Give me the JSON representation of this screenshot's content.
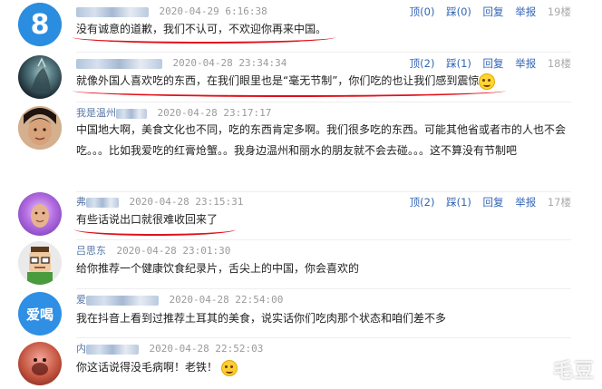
{
  "actions": {
    "up": "顶",
    "down": "踩",
    "reply": "回复",
    "report": "举报"
  },
  "comments": [
    {
      "user": "",
      "time": "2020-04-29 6:16:38",
      "up": "(0)",
      "down": "(0)",
      "floor": "19楼",
      "text": "没有诚意的道歉，我们不认可，不欢迎你再来中国。",
      "avatar": "blue-circle-8-avatar"
    },
    {
      "user": "",
      "time": "2020-04-28 23:34:34",
      "up": "(2)",
      "down": "(1)",
      "floor": "18楼",
      "text": "就像外国人喜欢吃的东西，在我们眼里也是“毫无节制”，你们吃的也让我们感到震惊",
      "avatar": "dark-fantasy-avatar"
    },
    {
      "user": "我是温州",
      "time": "2020-04-28 23:17:17",
      "up": "",
      "down": "",
      "floor": "",
      "text": "中国地大啊，美食文化也不同，吃的东西肯定多啊。我们很多吃的东西。可能其他省或者市的人也不会吃。。。比如我爱吃的红膏炝蟹。。我身边温州和丽水的朋友就不会去碰。。。这不算没有节制吧",
      "avatar": "person-photo-avatar"
    },
    {
      "user": "弗",
      "time": "2020-04-28 23:15:31",
      "up": "(2)",
      "down": "(1)",
      "floor": "17楼",
      "text": "有些话说出口就很难收回来了",
      "avatar": "purple-face-avatar"
    },
    {
      "user": "吕思东",
      "time": "2020-04-28 23:01:30",
      "up": "",
      "down": "",
      "floor": "",
      "text": "给你推荐一个健康饮食纪录片，舌尖上的中国，你会喜欢的",
      "avatar": "cartoon-man-avatar"
    },
    {
      "user": "爱",
      "time": "2020-04-28 22:54:00",
      "up": "",
      "down": "",
      "floor": "",
      "text": "我在抖音上看到过推荐土耳其的美食，说实话你们吃肉那个状态和咱们差不多",
      "avatar": "blue-circle-aihe-avatar",
      "avatar_text": "爱喝"
    },
    {
      "user": "内",
      "time": "2020-04-28 22:52:03",
      "up": "",
      "down": "",
      "floor": "",
      "text": "你这话说得没毛病啊！老铁！",
      "avatar": "red-face-avatar"
    }
  ],
  "watermark": "毛豆",
  "colors": {
    "link": "#3265b5",
    "underline": "#e1101a",
    "time": "#9a9a9a"
  }
}
